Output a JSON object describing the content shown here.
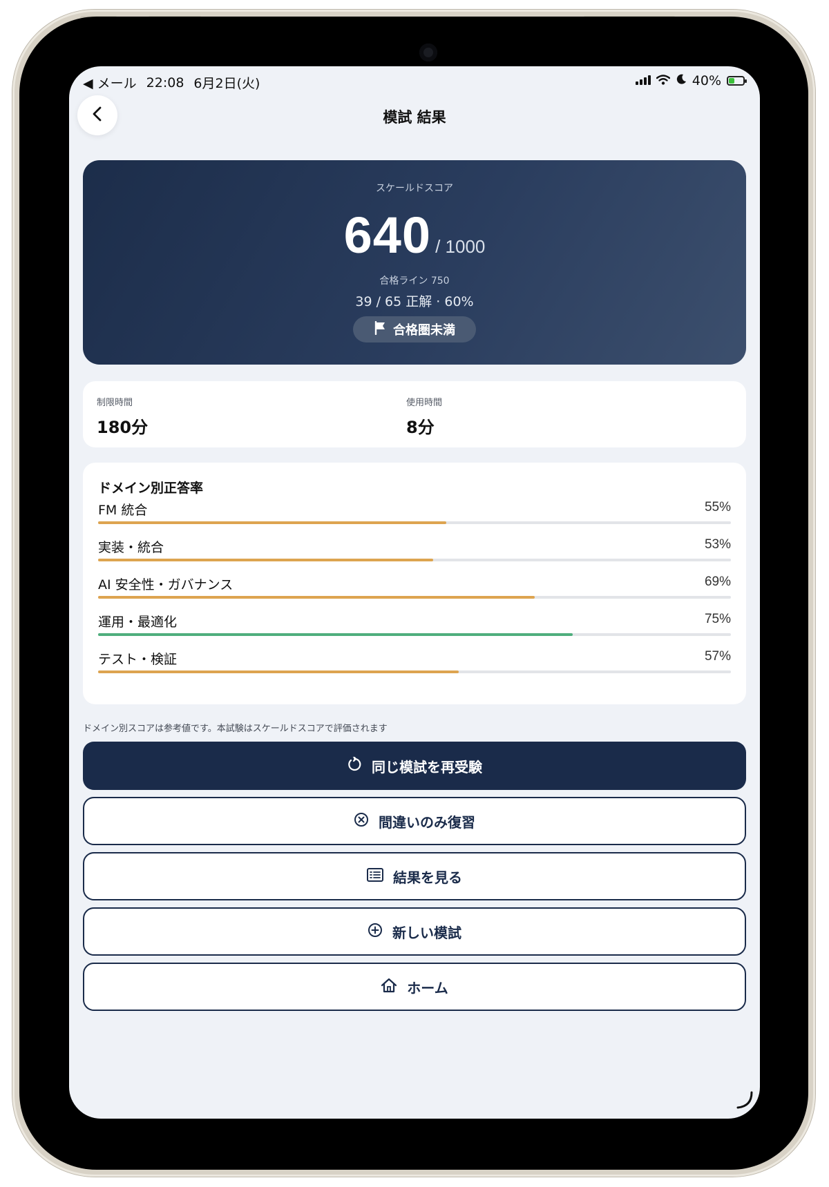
{
  "status_bar": {
    "back_app": "◀ メール",
    "time": "22:08",
    "date": "6月2日(火)",
    "battery": "40%",
    "battery_level": 0.4
  },
  "header": {
    "title": "模試 結果",
    "back_icon": "chevron-left-icon"
  },
  "score": {
    "label": "スケールドスコア",
    "value": "640",
    "max": "/ 1000",
    "pass_line": "合格ライン 750",
    "correct": "39 / 65 正解 · 60%",
    "status": "合格圏未満",
    "status_icon": "flag-icon"
  },
  "time": {
    "limit_label": "制限時間",
    "limit_value": "180分",
    "used_label": "使用時間",
    "used_value": "8分"
  },
  "domains": {
    "title": "ドメイン別正答率",
    "items": [
      {
        "name": "FM 統合",
        "pct_label": "55%",
        "value": 55,
        "color": "#dda450"
      },
      {
        "name": "実装・統合",
        "pct_label": "53%",
        "value": 53,
        "color": "#dda450"
      },
      {
        "name": "AI 安全性・ガバナンス",
        "pct_label": "69%",
        "value": 69,
        "color": "#dda450"
      },
      {
        "name": "運用・最適化",
        "pct_label": "75%",
        "value": 75,
        "color": "#4fae7d"
      },
      {
        "name": "テスト・検証",
        "pct_label": "57%",
        "value": 57,
        "color": "#dda450"
      }
    ],
    "note": "ドメイン別スコアは参考値です。本試験はスケールドスコアで評価されます"
  },
  "buttons": {
    "retry": "同じ模試を再受験",
    "review_wrong": "間違いのみ復習",
    "view_results": "結果を見る",
    "new_exam": "新しい模試",
    "home": "ホーム"
  },
  "colors": {
    "primary": "#1a2b4a",
    "warning_bar": "#dda450",
    "success_bar": "#4fae7d",
    "background": "#eff2f7"
  }
}
